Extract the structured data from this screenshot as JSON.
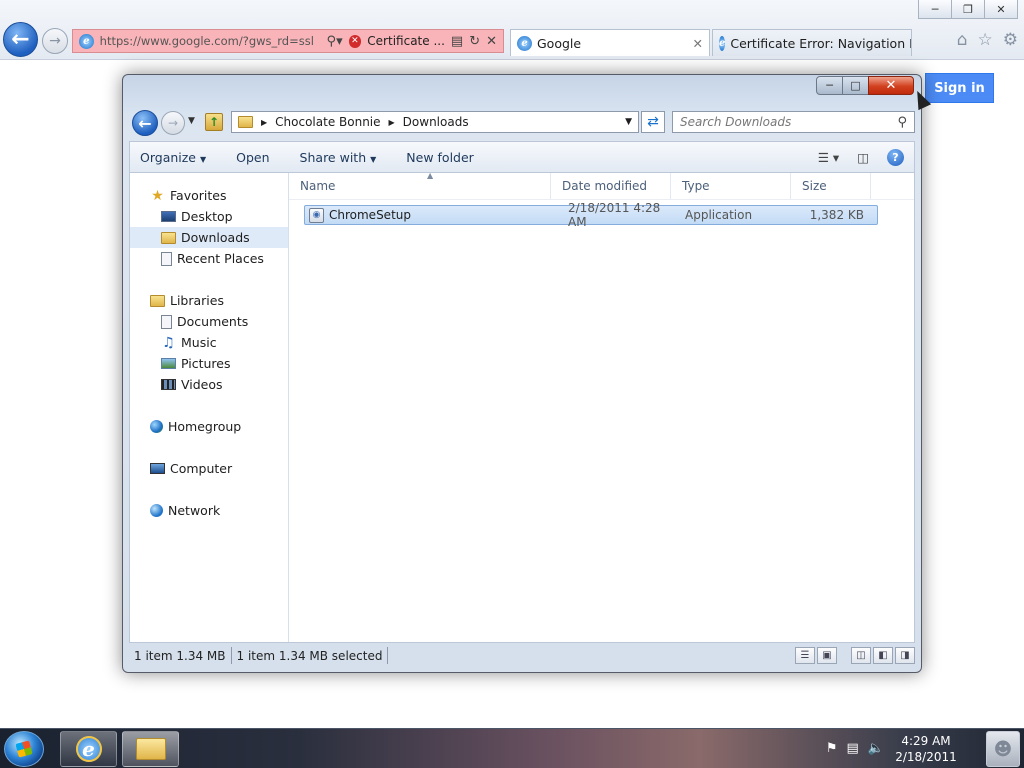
{
  "browser": {
    "address_url": "https://www.google.com/?gws_rd=ssl",
    "cert_label": "Certificate ...",
    "tabs": [
      {
        "label": "Google"
      },
      {
        "label": "Certificate Error: Navigation Bl..."
      }
    ],
    "sign_in": "Sign in"
  },
  "explorer": {
    "breadcrumb": [
      "Chocolate Bonnie",
      "Downloads"
    ],
    "search_placeholder": "Search Downloads",
    "commands": [
      "Organize",
      "Open",
      "Share with",
      "New folder"
    ],
    "nav": {
      "favorites": {
        "label": "Favorites",
        "items": [
          "Desktop",
          "Downloads",
          "Recent Places"
        ]
      },
      "libraries": {
        "label": "Libraries",
        "items": [
          "Documents",
          "Music",
          "Pictures",
          "Videos"
        ]
      },
      "homegroup": "Homegroup",
      "computer": "Computer",
      "network": "Network"
    },
    "columns": [
      "Name",
      "Date modified",
      "Type",
      "Size"
    ],
    "files": [
      {
        "name": "ChromeSetup",
        "date": "2/18/2011 4:28 AM",
        "type": "Application",
        "size": "1,382 KB"
      }
    ],
    "status": {
      "total": "1 item 1.34 MB",
      "selected": "1 item 1.34 MB selected"
    }
  },
  "taskbar": {
    "time": "4:29 AM",
    "date": "2/18/2011"
  },
  "colors": {
    "accent_blue": "#4c8bf5",
    "selection": "#c3dbf6",
    "close_red": "#d1401f",
    "cert_error_bg": "#f8b4b8"
  }
}
